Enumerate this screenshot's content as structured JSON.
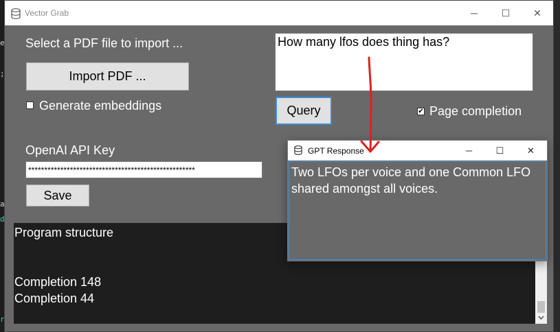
{
  "background_fragments": [
    "e",
    ";",
    "a",
    "d",
    "r"
  ],
  "main_window": {
    "title": "Vector Grab",
    "title_icon": "database-icon",
    "controls": {
      "minimize": "─",
      "maximize": "☐",
      "close": "✕"
    }
  },
  "import": {
    "prompt_label": "Select a PDF file to import ...",
    "button_label": "Import PDF ...",
    "embeddings_label": "Generate embeddings",
    "embeddings_checked": false
  },
  "api": {
    "label": "OpenAI API Key",
    "value": "****************************************************",
    "save_label": "Save"
  },
  "query": {
    "question": "How many lfos does thing has?",
    "button_label": "Query",
    "page_completion_label": "Page completion",
    "page_completion_checked": true
  },
  "output": {
    "lines": [
      "Program structure",
      "",
      "",
      "Completion 148",
      "Completion 44"
    ]
  },
  "popup": {
    "title": "GPT Response",
    "title_icon": "database-icon",
    "response": "Two LFOs per voice and one Common LFO shared amongst all voices.",
    "controls": {
      "minimize": "─",
      "maximize": "☐",
      "close": "✕"
    }
  },
  "colors": {
    "window_bg": "#696969",
    "output_bg": "#1e1e1e",
    "focus_border": "#3c8fd6",
    "annotation_arrow": "#e02020"
  }
}
